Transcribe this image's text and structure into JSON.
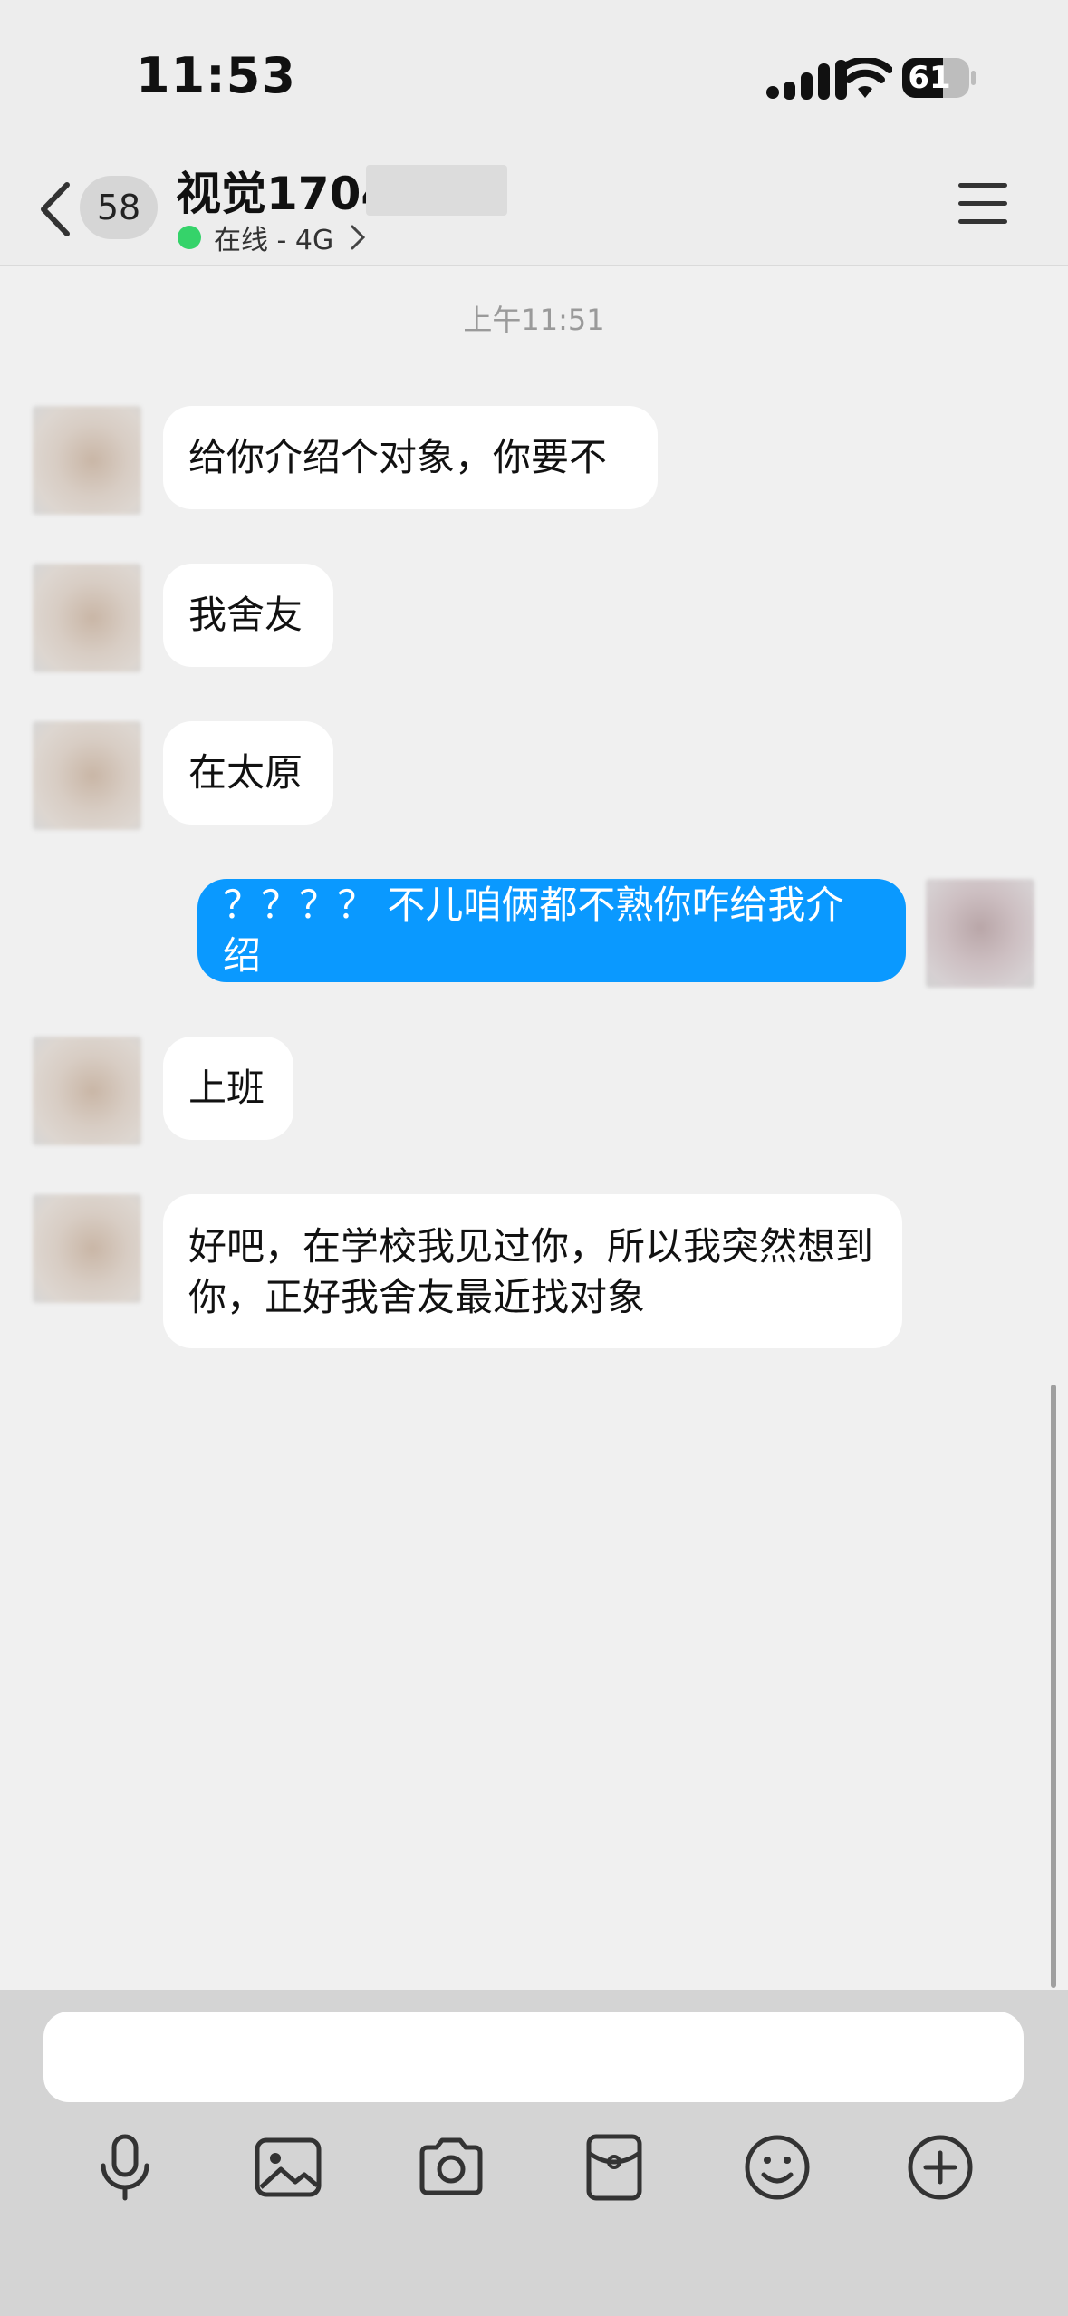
{
  "status_bar": {
    "time": "11:53",
    "battery": "61",
    "battery_level": 0.61,
    "icons": [
      "signal-icon",
      "wifi-icon",
      "battery-icon"
    ]
  },
  "header": {
    "back_icon": "chevron-left-icon",
    "unread_count": "58",
    "contact_name": "视觉1704",
    "presence": "在线 - 4G",
    "menu_icon": "hamburger-menu-icon"
  },
  "chat": {
    "timestamp": "上午11:51",
    "messages": [
      {
        "from": "them",
        "text": "给你介绍个对象，你要不"
      },
      {
        "from": "them",
        "text": "我舍友"
      },
      {
        "from": "them",
        "text": "在太原"
      },
      {
        "from": "me",
        "text": "？？？？ 不儿咱俩都不熟你咋给我介绍"
      },
      {
        "from": "them",
        "text": "上班"
      },
      {
        "from": "them",
        "text": "好吧，在学校我见过你，所以我突然想到你，正好我舍友最近找对象"
      }
    ]
  },
  "input": {
    "placeholder": "",
    "value": ""
  },
  "toolbar": {
    "items": [
      "microphone-icon",
      "image-icon",
      "camera-icon",
      "red-packet-icon",
      "emoji-icon",
      "plus-icon"
    ]
  },
  "colors": {
    "my_bubble": "#0a99ff",
    "their_bubble": "#ffffff",
    "online_dot": "#35d36a",
    "background": "#f0f0f0"
  }
}
